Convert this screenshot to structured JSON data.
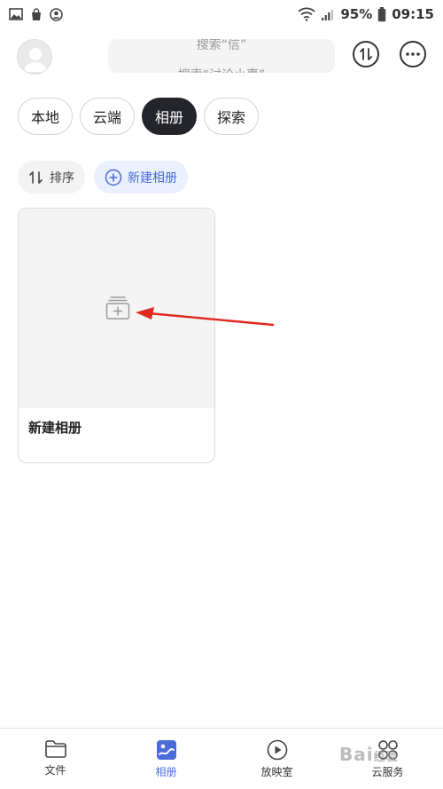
{
  "status_bar": {
    "battery": "95%",
    "time": "09:15"
  },
  "header": {
    "search_line_1": "搜索“信”",
    "search_line_2": "搜索“讨论小事”"
  },
  "tabs": [
    {
      "label": "本地",
      "active": false
    },
    {
      "label": "云端",
      "active": false
    },
    {
      "label": "相册",
      "active": true
    },
    {
      "label": "探索",
      "active": false
    }
  ],
  "actions": {
    "sort_label": "排序",
    "new_album_label": "新建相册"
  },
  "album_card": {
    "label": "新建相册"
  },
  "bottom_nav": [
    {
      "label": "文件",
      "icon": "folder-icon"
    },
    {
      "label": "相册",
      "icon": "album-icon",
      "active": true
    },
    {
      "label": "放映室",
      "icon": "play-icon"
    },
    {
      "label": "云服务",
      "icon": "cloud-service-icon"
    }
  ],
  "watermark": {
    "text": "Bai",
    "tail": "经验"
  },
  "colors": {
    "accent": "#4a6bd8",
    "active_tab": "#23252a",
    "annotation_arrow": "#e0281f"
  }
}
